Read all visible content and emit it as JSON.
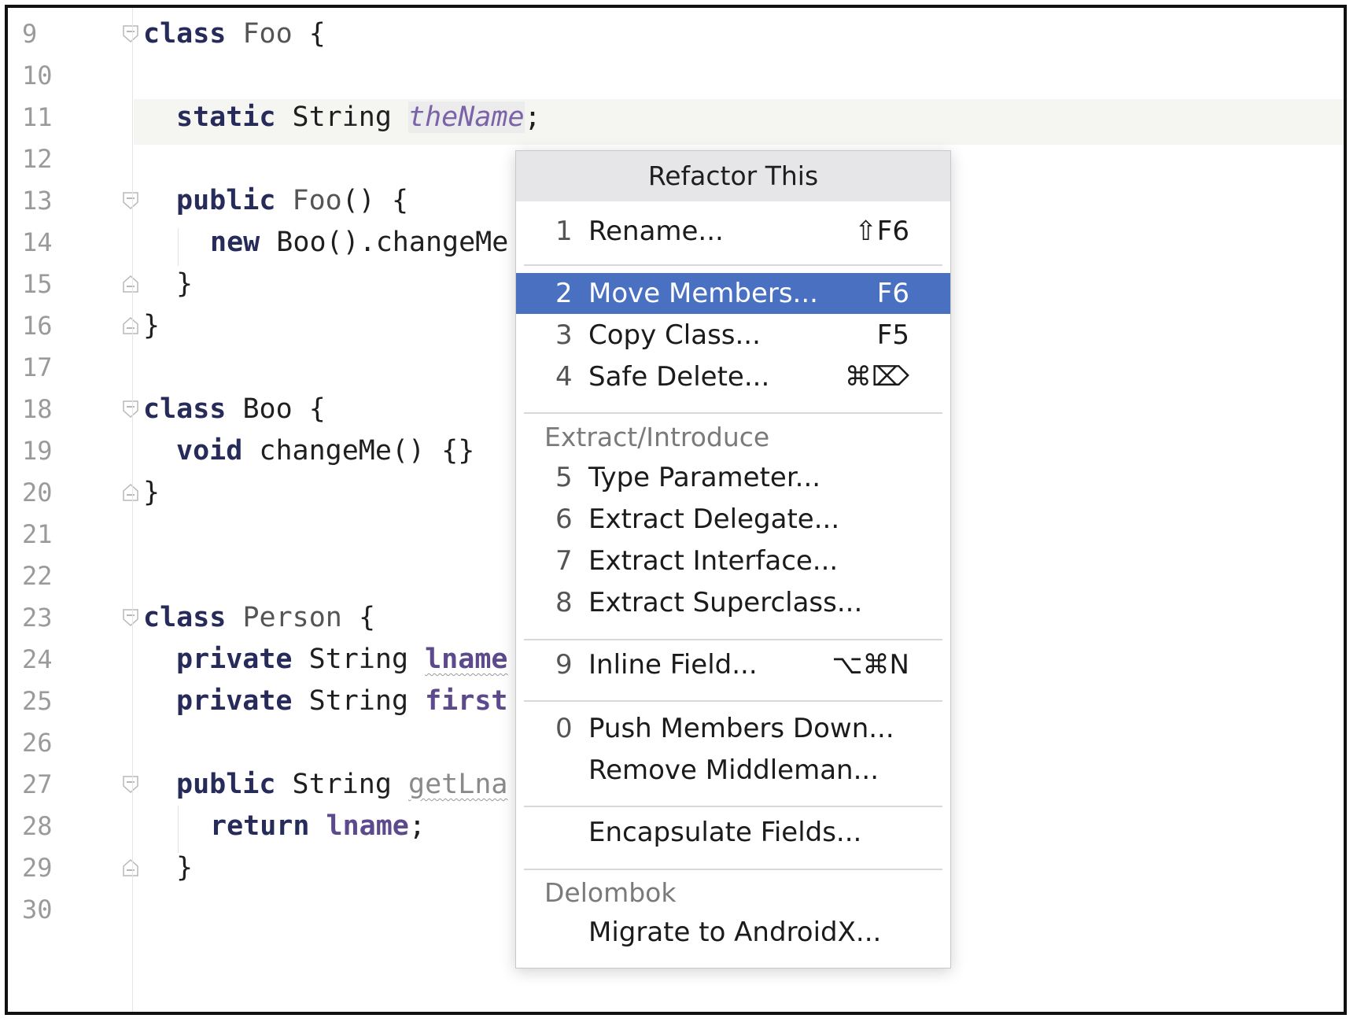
{
  "editor": {
    "line_numbers": [
      "9",
      "10",
      "11",
      "12",
      "13",
      "14",
      "15",
      "16",
      "17",
      "18",
      "19",
      "20",
      "21",
      "22",
      "23",
      "24",
      "25",
      "26",
      "27",
      "28",
      "29",
      "30"
    ],
    "lines": {
      "l9": {
        "kw": "class",
        "name": "Foo",
        "rest": " {"
      },
      "l11": {
        "kw": "static",
        "type": "String",
        "field": "theName",
        "rest": ";"
      },
      "l13": {
        "kw": "public",
        "name": "Foo",
        "rest": "() {"
      },
      "l14": {
        "kw": "new",
        "rest": "Boo().changeMe"
      },
      "l15": {
        "rest": "}"
      },
      "l16": {
        "rest": "}"
      },
      "l18": {
        "kw": "class",
        "name": "Boo",
        "rest": " {"
      },
      "l19": {
        "kw": "void",
        "rest": "changeMe() {}"
      },
      "l20": {
        "rest": "}"
      },
      "l23": {
        "kw": "class",
        "name": "Person",
        "rest": " {"
      },
      "l24": {
        "kw": "private",
        "type": "String",
        "field": "lname"
      },
      "l25": {
        "kw": "private",
        "type": "String",
        "field": "first"
      },
      "l27": {
        "kw": "public",
        "type": "String",
        "name": "getLna"
      },
      "l28": {
        "kw": "return",
        "field": "lname",
        "rest": ";"
      },
      "l29": {
        "rest": "}"
      }
    }
  },
  "popup": {
    "title": "Refactor This",
    "items": [
      {
        "num": "1",
        "label": "Rename...",
        "shortcut": "⇧F6"
      },
      {
        "num": "2",
        "label": "Move Members...",
        "shortcut": "F6",
        "selected": true
      },
      {
        "num": "3",
        "label": "Copy Class...",
        "shortcut": "F5"
      },
      {
        "num": "4",
        "label": "Safe Delete...",
        "shortcut": "⌘⌦"
      },
      {
        "num": "5",
        "label": "Type Parameter...",
        "shortcut": ""
      },
      {
        "num": "6",
        "label": "Extract Delegate...",
        "shortcut": ""
      },
      {
        "num": "7",
        "label": "Extract Interface...",
        "shortcut": ""
      },
      {
        "num": "8",
        "label": "Extract Superclass...",
        "shortcut": ""
      },
      {
        "num": "9",
        "label": "Inline Field...",
        "shortcut": "⌥⌘N"
      },
      {
        "num": "0",
        "label": "Push Members Down...",
        "shortcut": ""
      },
      {
        "num": "",
        "label": "Remove Middleman...",
        "shortcut": ""
      },
      {
        "num": "",
        "label": "Encapsulate Fields...",
        "shortcut": ""
      },
      {
        "num": "",
        "label": "Migrate to AndroidX...",
        "shortcut": ""
      }
    ],
    "groups": {
      "extract": "Extract/Introduce",
      "delombok": "Delombok"
    }
  },
  "colors": {
    "selection": "#4a70c2",
    "keyword": "#262b5a",
    "field": "#7a63a6",
    "current_line": "#f5f5f2"
  }
}
